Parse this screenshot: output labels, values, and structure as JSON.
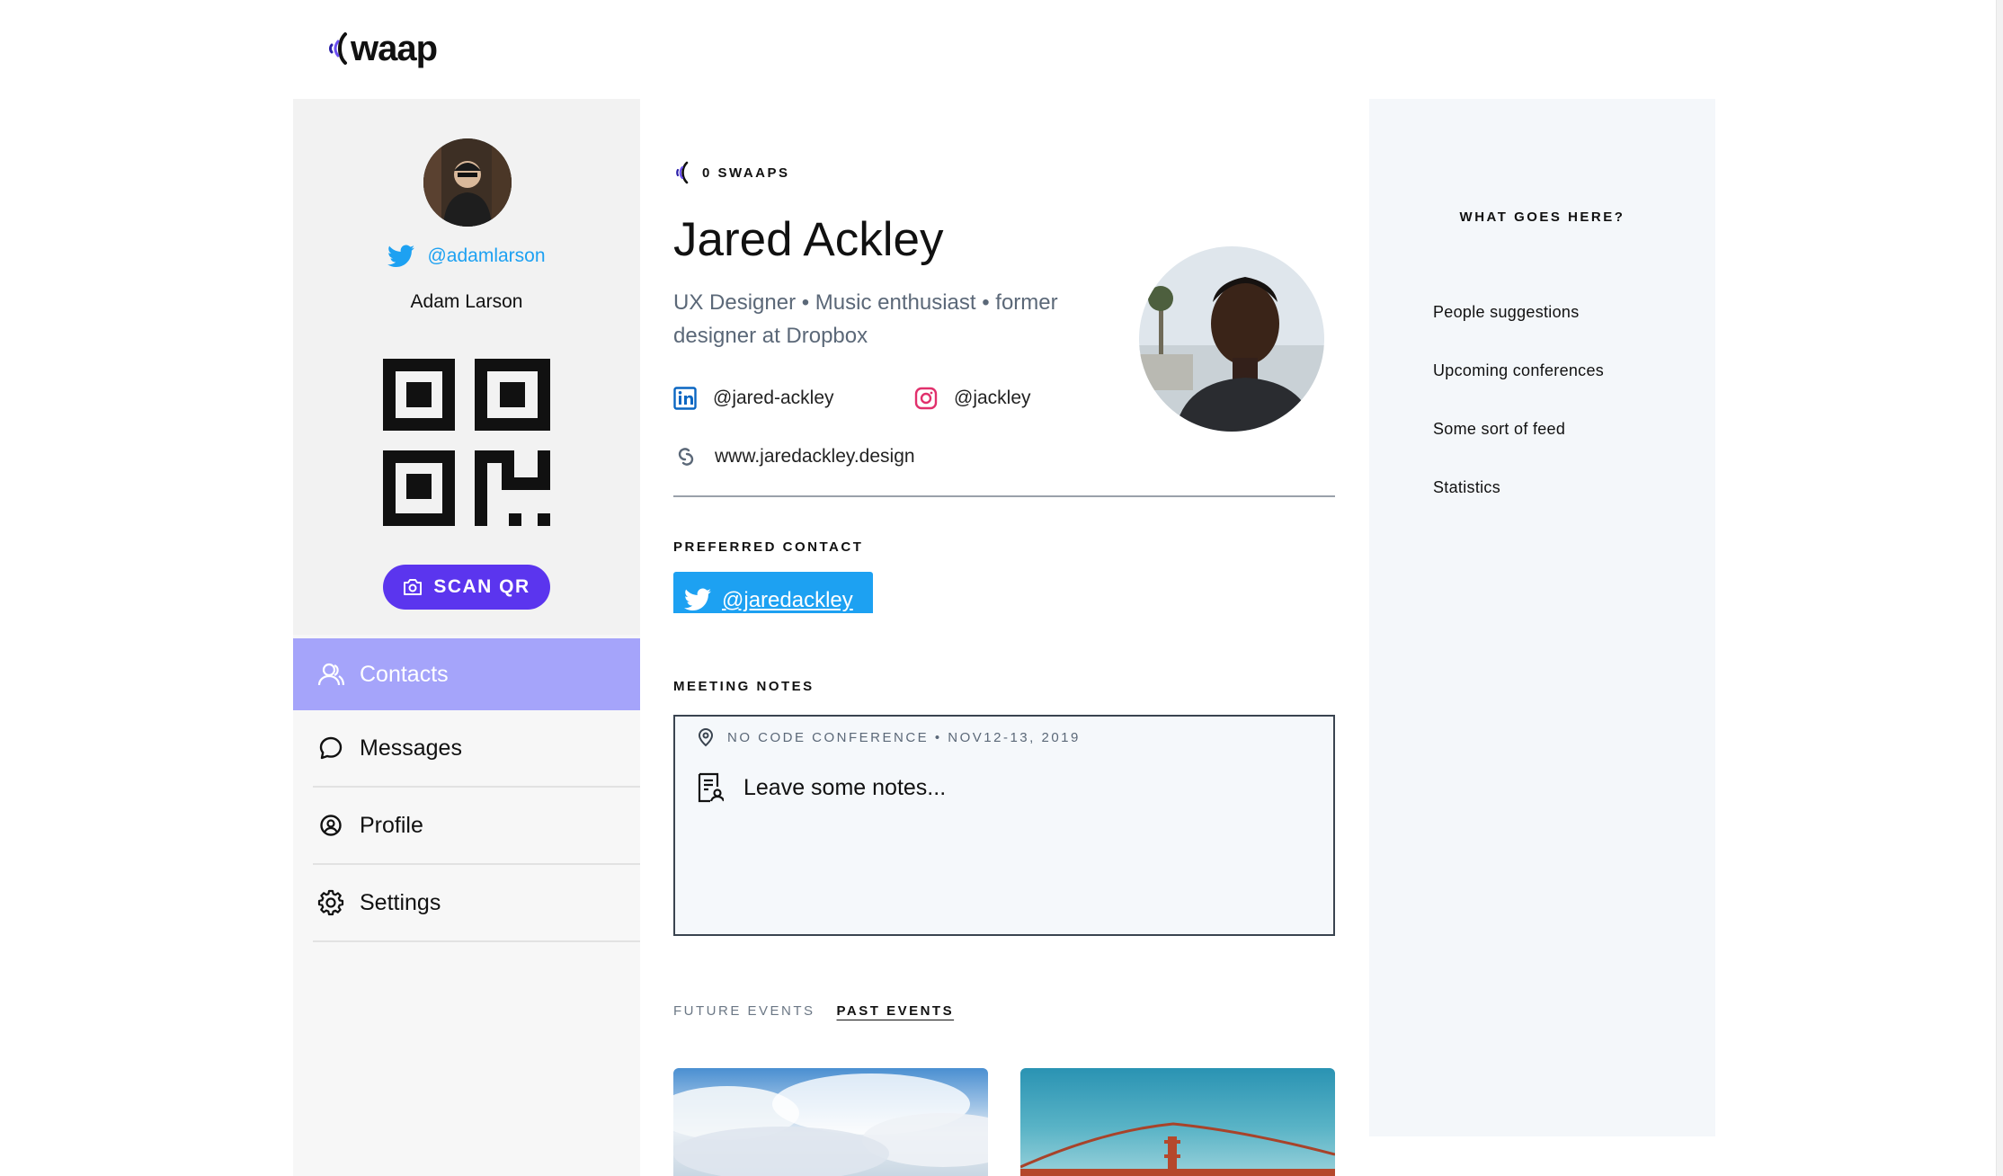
{
  "app": {
    "logo_text": "waap",
    "brand_color": "#5b35ee"
  },
  "sidebar": {
    "user": {
      "twitter_handle": "@adamlarson",
      "name": "Adam Larson"
    },
    "scan_button_label": "SCAN QR",
    "nav": [
      {
        "label": "Contacts",
        "icon": "contacts-icon",
        "active": true
      },
      {
        "label": "Messages",
        "icon": "chat-bubble-icon",
        "active": false
      },
      {
        "label": "Profile",
        "icon": "profile-icon",
        "active": false
      },
      {
        "label": "Settings",
        "icon": "gear-icon",
        "active": false
      }
    ]
  },
  "contact": {
    "swaaps_count": "0 SWAAPS",
    "name": "Jared Ackley",
    "bio": "UX Designer • Music enthusiast • former designer at Dropbox",
    "linkedin": "@jared-ackley",
    "instagram": "@jackley",
    "website": "www.jaredackley.design",
    "preferred_contact_label": "PREFERRED CONTACT",
    "preferred_contact_handle": "@jaredackley",
    "meeting_notes_label": "MEETING NOTES",
    "meeting_event": "NO CODE CONFERENCE • NOV12-13, 2019",
    "notes_placeholder": "Leave some notes...",
    "tabs": [
      {
        "label": "FUTURE EVENTS",
        "active": false
      },
      {
        "label": "PAST EVENTS",
        "active": true
      }
    ]
  },
  "right_panel": {
    "title": "WHAT GOES HERE?",
    "items": [
      "People suggestions",
      "Upcoming conferences",
      "Some sort of feed",
      "Statistics"
    ]
  },
  "colors": {
    "twitter": "#1da1f2",
    "nav_active": "#a5a4fa",
    "instagram": "#e1306c",
    "linkedin": "#0a66c2"
  }
}
